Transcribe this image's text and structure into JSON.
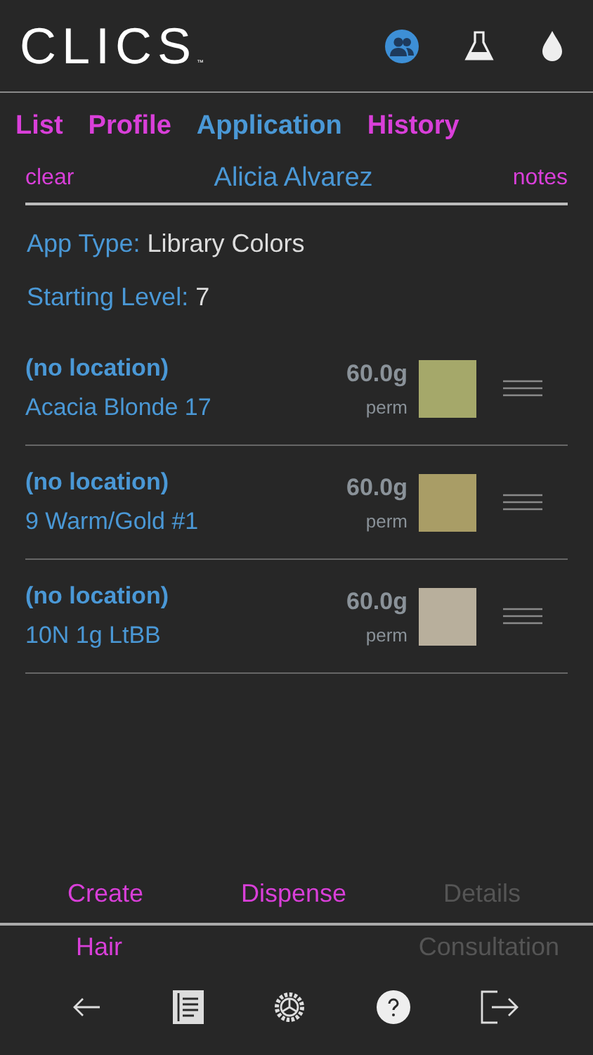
{
  "header": {
    "logo": "CLICS",
    "trademark": "™",
    "icons": [
      {
        "kind": "clients",
        "selected": true
      },
      {
        "kind": "flask",
        "selected": false
      },
      {
        "kind": "drop",
        "selected": false
      }
    ]
  },
  "tabs": [
    {
      "label": "List",
      "selected": false
    },
    {
      "label": "Profile",
      "selected": false
    },
    {
      "label": "Application",
      "selected": true
    },
    {
      "label": "History",
      "selected": false
    }
  ],
  "client": {
    "clear": "clear",
    "name": "Alicia Alvarez",
    "notes": "notes"
  },
  "fields": [
    {
      "label": "App Type:",
      "value": "Library Colors"
    },
    {
      "label": "Starting Level:",
      "value": "7"
    }
  ],
  "formulas": [
    {
      "location": "(no location)",
      "name": "Acacia Blonde 17",
      "amount": "60.0g",
      "type": "perm",
      "color": "#a5a86a"
    },
    {
      "location": "(no location)",
      "name": "9 Warm/Gold #1",
      "amount": "60.0g",
      "type": "perm",
      "color": "#a99d66"
    },
    {
      "location": "(no location)",
      "name": "10N 1g LtBB",
      "amount": "60.0g",
      "type": "perm",
      "color": "#b8af9c"
    }
  ],
  "actions": [
    {
      "label": "Create",
      "disabled": false
    },
    {
      "label": "Dispense",
      "disabled": false
    },
    {
      "label": "Details",
      "disabled": true
    }
  ],
  "actions_second_row": [
    {
      "label": "Hair",
      "disabled": false
    },
    {
      "label": "Consultation",
      "disabled": true
    }
  ],
  "toolbar": [
    {
      "kind": "back"
    },
    {
      "kind": "document"
    },
    {
      "kind": "gear"
    },
    {
      "kind": "help"
    },
    {
      "kind": "exit"
    }
  ]
}
